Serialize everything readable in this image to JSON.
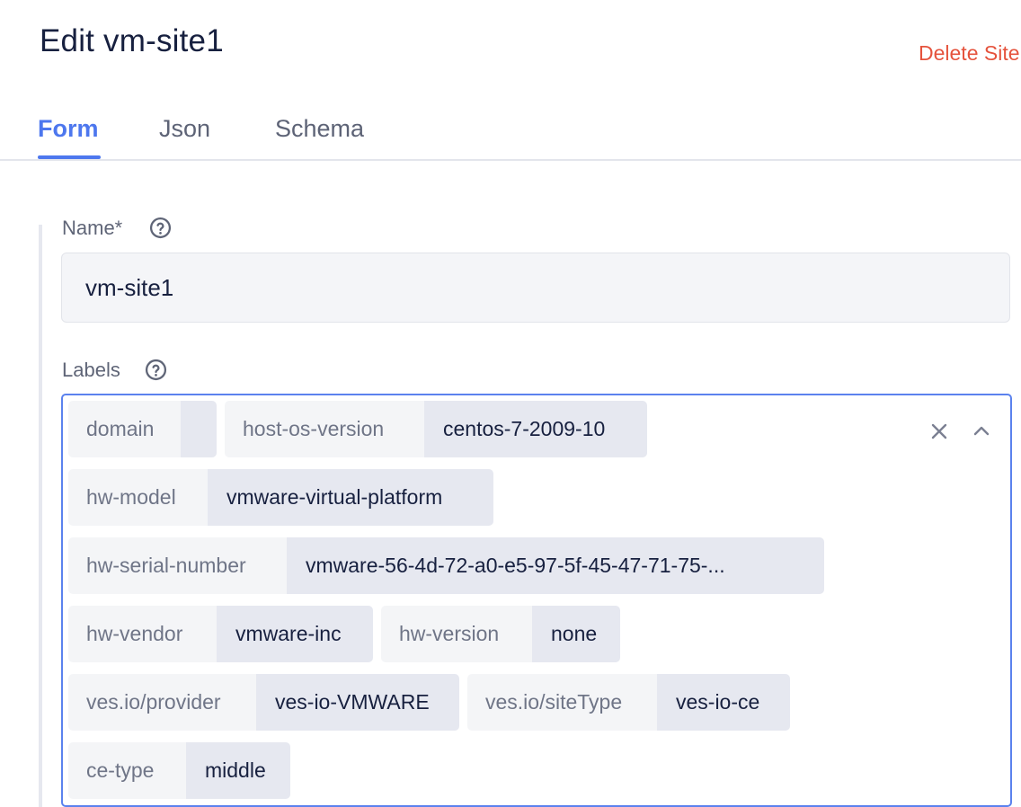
{
  "header": {
    "title": "Edit vm-site1",
    "delete_label": "Delete Site"
  },
  "tabs": [
    {
      "label": "Form",
      "active": true
    },
    {
      "label": "Json",
      "active": false
    },
    {
      "label": "Schema",
      "active": false
    }
  ],
  "form": {
    "name": {
      "label": "Name*",
      "value": "vm-site1"
    },
    "labels": {
      "label": "Labels",
      "items": [
        {
          "key": "domain",
          "value": ""
        },
        {
          "key": "host-os-version",
          "value": "centos-7-2009-10"
        },
        {
          "key": "hw-model",
          "value": "vmware-virtual-platform"
        },
        {
          "key": "hw-serial-number",
          "value": "vmware-56-4d-72-a0-e5-97-5f-45-47-71-75-..."
        },
        {
          "key": "hw-vendor",
          "value": "vmware-inc"
        },
        {
          "key": "hw-version",
          "value": "none"
        },
        {
          "key": "ves.io/provider",
          "value": "ves-io-VMWARE"
        },
        {
          "key": "ves.io/siteType",
          "value": "ves-io-ce"
        },
        {
          "key": "ce-type",
          "value": "middle"
        }
      ]
    }
  },
  "icons": {
    "help": "question-circle-icon",
    "clear": "close-icon",
    "collapse": "chevron-up-icon"
  },
  "colors": {
    "accent": "#4d77ee",
    "danger": "#e5533d",
    "text": "#17203f"
  }
}
